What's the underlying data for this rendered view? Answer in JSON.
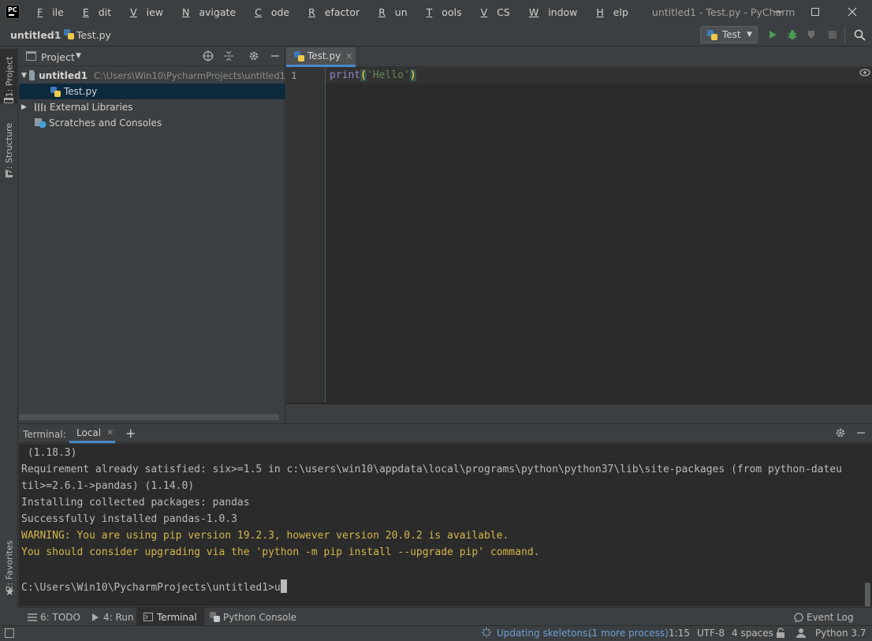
{
  "titlebar": {
    "logo": "PC",
    "menu": [
      {
        "mn": "F",
        "rest": "ile"
      },
      {
        "mn": "E",
        "rest": "dit"
      },
      {
        "mn": "V",
        "rest": "iew"
      },
      {
        "mn": "N",
        "rest": "avigate"
      },
      {
        "mn": "C",
        "rest": "ode"
      },
      {
        "mn": "R",
        "rest": "efactor"
      },
      {
        "mn": "R",
        "rest": "un"
      },
      {
        "mn": "T",
        "rest": "ools"
      },
      {
        "mn": "V",
        "rest": "CS"
      },
      {
        "mn": "W",
        "rest": "indow"
      },
      {
        "mn": "H",
        "rest": "elp"
      }
    ],
    "window_title": "untitled1 - Test.py - PyCharm"
  },
  "navbar": {
    "root": "untitled1",
    "file": "Test.py",
    "run_config": "Test"
  },
  "left_stripe": {
    "project_tab": "1: Project",
    "structure_tab": "7: Structure",
    "favorites_tab": "2: Favorites"
  },
  "project": {
    "title": "Project",
    "tree": {
      "root_name": "untitled1",
      "root_path": "C:\\Users\\Win10\\PycharmProjects\\untitled1",
      "file": "Test.py",
      "external": "External Libraries",
      "scratches": "Scratches and Consoles"
    }
  },
  "editor": {
    "tab": "Test.py",
    "line_number": "1",
    "code": {
      "func": "print",
      "open": "(",
      "string": "'Hello'",
      "close": ")"
    }
  },
  "terminal": {
    "label": "Terminal:",
    "tab": "Local",
    "lines": [
      " (1.18.3)",
      "Requirement already satisfied: six>=1.5 in c:\\users\\win10\\appdata\\local\\programs\\python\\python37\\lib\\site-packages (from python-dateu",
      "til>=2.6.1->pandas) (1.14.0)",
      "Installing collected packages: pandas",
      "Successfully installed pandas-1.0.3"
    ],
    "warnings": [
      "WARNING: You are using pip version 19.2.3, however version 20.0.2 is available.",
      "You should consider upgrading via the 'python -m pip install --upgrade pip' command."
    ],
    "prompt": "C:\\Users\\Win10\\PycharmProjects\\untitled1>u"
  },
  "tool_windows": {
    "todo": "6: TODO",
    "run": "4: Run",
    "terminal": "Terminal",
    "python_console": "Python Console",
    "event_log": "Event Log"
  },
  "status": {
    "progress": "Updating skeletons...",
    "more": "(1 more process)",
    "position": "1:15",
    "encoding": "UTF-8",
    "indent": "4 spaces",
    "interpreter": "Python 3.7"
  }
}
